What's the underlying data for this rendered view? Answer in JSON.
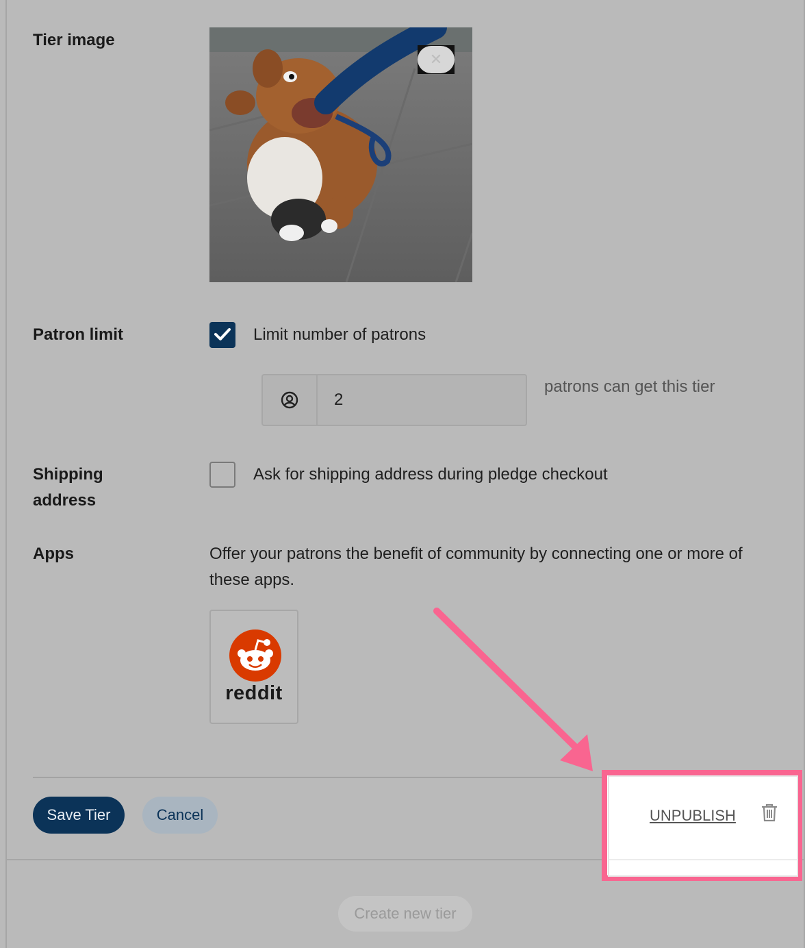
{
  "tier_image": {
    "label": "Tier image",
    "remove_icon": "close-icon"
  },
  "patron_limit": {
    "label": "Patron limit",
    "checkbox_label": "Limit number of patrons",
    "checked": true,
    "input_icon": "user-circle-icon",
    "input_value": "2",
    "suffix": "patrons can get this tier"
  },
  "shipping": {
    "label_line1": "Shipping",
    "label_line2": "address",
    "checkbox_label": "Ask for shipping address during pledge checkout",
    "checked": false
  },
  "apps": {
    "label": "Apps",
    "description": "Offer your patrons the benefit of community by connecting one or more of these apps.",
    "items": [
      {
        "name": "reddit",
        "icon": "reddit-logo-icon",
        "brand_color": "#d93a00"
      }
    ]
  },
  "actions": {
    "save_label": "Save Tier",
    "cancel_label": "Cancel",
    "unpublish_label": "UNPUBLISH",
    "delete_icon": "trash-icon"
  },
  "create_new_tier_label": "Create new tier",
  "colors": {
    "primary": "#0b3358",
    "overlay_background": "#bababa",
    "annotation": "#f96590"
  }
}
